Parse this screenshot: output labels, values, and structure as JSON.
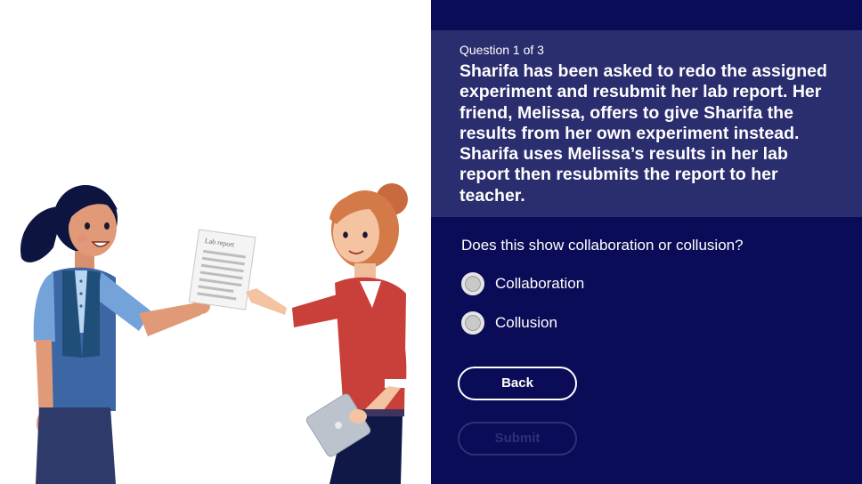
{
  "quiz": {
    "counter": "Question 1 of 3",
    "question": "Sharifa has been asked to redo the assigned experiment and resubmit her lab report. Her friend, Melissa, offers to give Sharifa the results from her own experiment instead. Sharifa uses Melissa’s results in her lab report then resubmits the report to her teacher.",
    "prompt": "Does this show collaboration or collusion?",
    "options": [
      {
        "label": "Collaboration",
        "selected": false
      },
      {
        "label": "Collusion",
        "selected": false
      }
    ],
    "back_label": "Back",
    "submit_label": "Submit",
    "submit_enabled": false
  },
  "illustration": {
    "paper_title": "Lab report"
  },
  "colors": {
    "panel_background": "#0a0c57",
    "question_background": "#2a2d6e",
    "text": "#ffffff",
    "disabled_button": "#2d3276"
  }
}
